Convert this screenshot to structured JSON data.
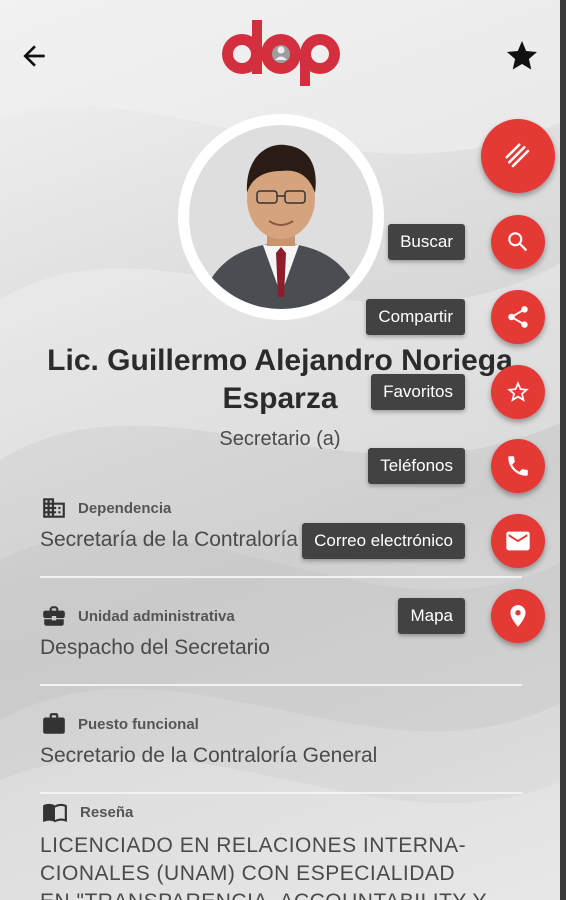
{
  "header": {
    "back_icon": "arrow-left-icon",
    "favorite_icon": "star-icon",
    "logo_text": "dap"
  },
  "profile": {
    "name": "Lic. Guillermo Alejandro Noriega Esparza",
    "role": "Secretario (a)"
  },
  "fields": [
    {
      "icon": "building-icon",
      "label": "Dependencia",
      "value": "Secretaría de la Contraloría General"
    },
    {
      "icon": "briefcase-icon",
      "label": "Unidad administrativa",
      "value": "Despacho del Secretario"
    },
    {
      "icon": "work-icon",
      "label": "Puesto funcional",
      "value": "Secretario de la Contraloría General"
    },
    {
      "icon": "book-icon",
      "label": "Reseña",
      "value_lines": [
        "LICENCIADO EN RELACIONES INTERNA-",
        "CIONALES (UNAM) CON ESPECIALIDAD",
        "EN \"TRANSPARENCIA, ACCOUNTABILITY Y"
      ]
    }
  ],
  "fab_menu": {
    "toggle_icon": "lines-icon",
    "actions": [
      {
        "label": "Buscar",
        "icon": "search-icon"
      },
      {
        "label": "Compartir",
        "icon": "share-icon"
      },
      {
        "label": "Favoritos",
        "icon": "star-outline-icon"
      },
      {
        "label": "Teléfonos",
        "icon": "phone-icon"
      },
      {
        "label": "Correo electrónico",
        "icon": "email-icon"
      },
      {
        "label": "Mapa",
        "icon": "map-pin-icon"
      }
    ]
  },
  "colors": {
    "accent": "#e53935",
    "label_bg": "#424242",
    "text": "#4a4a4a"
  }
}
